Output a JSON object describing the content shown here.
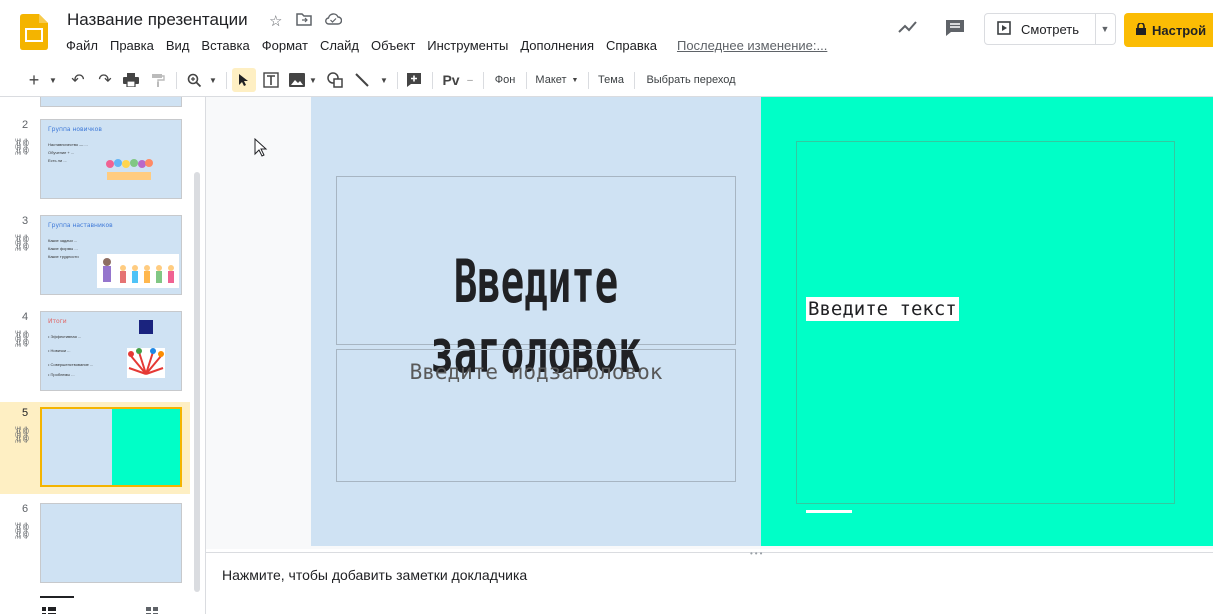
{
  "header": {
    "title": "Название презентации",
    "menu": [
      "Файл",
      "Правка",
      "Вид",
      "Вставка",
      "Формат",
      "Слайд",
      "Объект",
      "Инструменты",
      "Дополнения",
      "Справка"
    ],
    "last_edit": "Последнее изменение:...",
    "present_label": "Смотреть",
    "share_label": "Настрой",
    "accent": "#fbbc04"
  },
  "toolbar": {
    "background_label": "Фон",
    "layout_label": "Макет",
    "theme_label": "Тема",
    "transition_label": "Выбрать переход"
  },
  "filmstrip": {
    "slides": [
      {
        "num": "2",
        "title": "Группа новичков",
        "lines": [
          "Наставничество — ...",
          "Обучение + ...",
          "Есть ли ..."
        ]
      },
      {
        "num": "3",
        "title": "Группа наставников",
        "lines": [
          "Какие задачи ...",
          "Какие формы ...",
          "Какие трудности"
        ]
      },
      {
        "num": "4",
        "title": "Итоги",
        "lines": [
          "• Эффективная ...",
          "• Новички ...",
          "• Совершенствование ...",
          "• Проблемы ..."
        ]
      },
      {
        "num": "5",
        "title": "",
        "lines": []
      },
      {
        "num": "6",
        "title": "",
        "lines": []
      }
    ]
  },
  "slide": {
    "title_placeholder": "Введите заголовок",
    "subtitle_placeholder": "Введите подзаголовок",
    "body_placeholder": "Введите текст",
    "left_color": "#cfe2f3",
    "right_color": "#00ffc7"
  },
  "notes": {
    "placeholder": "Нажмите, чтобы добавить заметки докладчика"
  }
}
